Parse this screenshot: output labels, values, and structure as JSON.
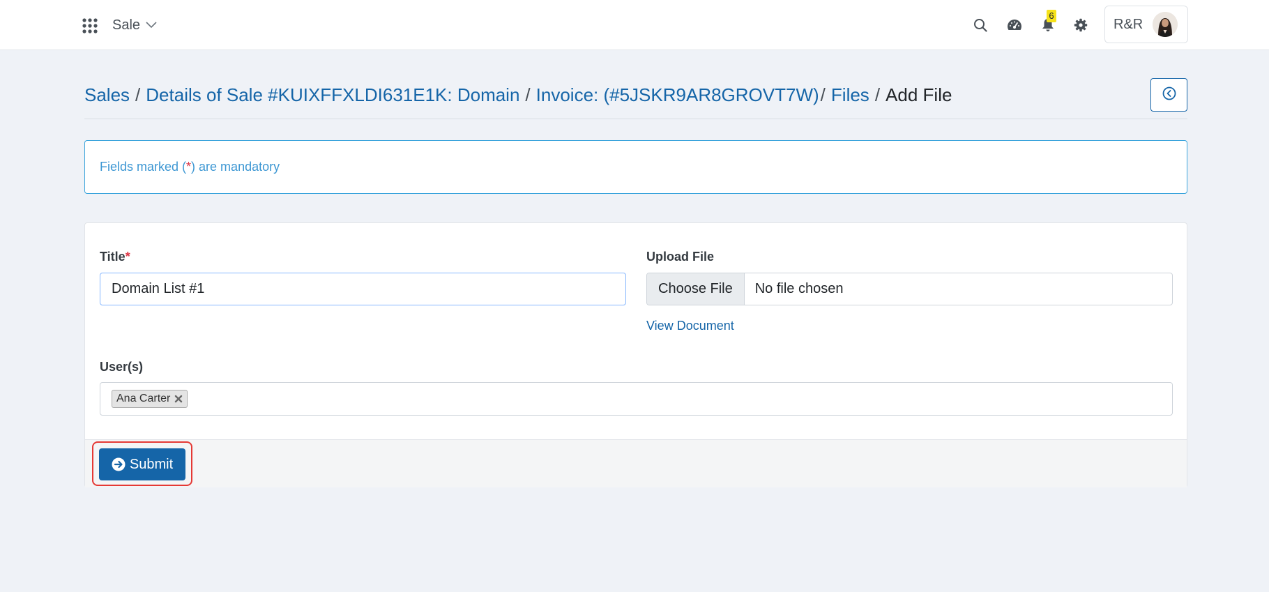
{
  "header": {
    "module": "Sale",
    "notification_count": "6",
    "user_initials": "R&R"
  },
  "breadcrumb": {
    "items": [
      "Sales",
      "Details of Sale #KUIXFFXLDI631E1K: Domain",
      "Invoice: (#5JSKR9AR8GROVT7W)",
      "Files"
    ],
    "current": "Add File"
  },
  "alert": {
    "prefix": "Fields marked (",
    "marker": "*",
    "suffix": ") are mandatory"
  },
  "form": {
    "title_label": "Title",
    "required_marker": "*",
    "title_value": "Domain List #1",
    "upload_label": "Upload File",
    "choose_file_label": "Choose File",
    "file_status": "No file chosen",
    "view_document_label": "View Document",
    "users_label": "User(s)",
    "selected_users": [
      "Ana Carter"
    ],
    "submit_label": "Submit"
  },
  "colors": {
    "brand": "#1565a8",
    "info": "#3aa4dc",
    "required": "#dc3545",
    "badge": "#f6e21a",
    "focus_ring": "#e53935"
  },
  "icons": [
    "apps-grid-icon",
    "chevron-down-icon",
    "search-icon",
    "dashboard-icon",
    "bell-icon",
    "gear-icon",
    "arrow-left-circle-icon",
    "close-icon",
    "arrow-right-circle-icon"
  ]
}
